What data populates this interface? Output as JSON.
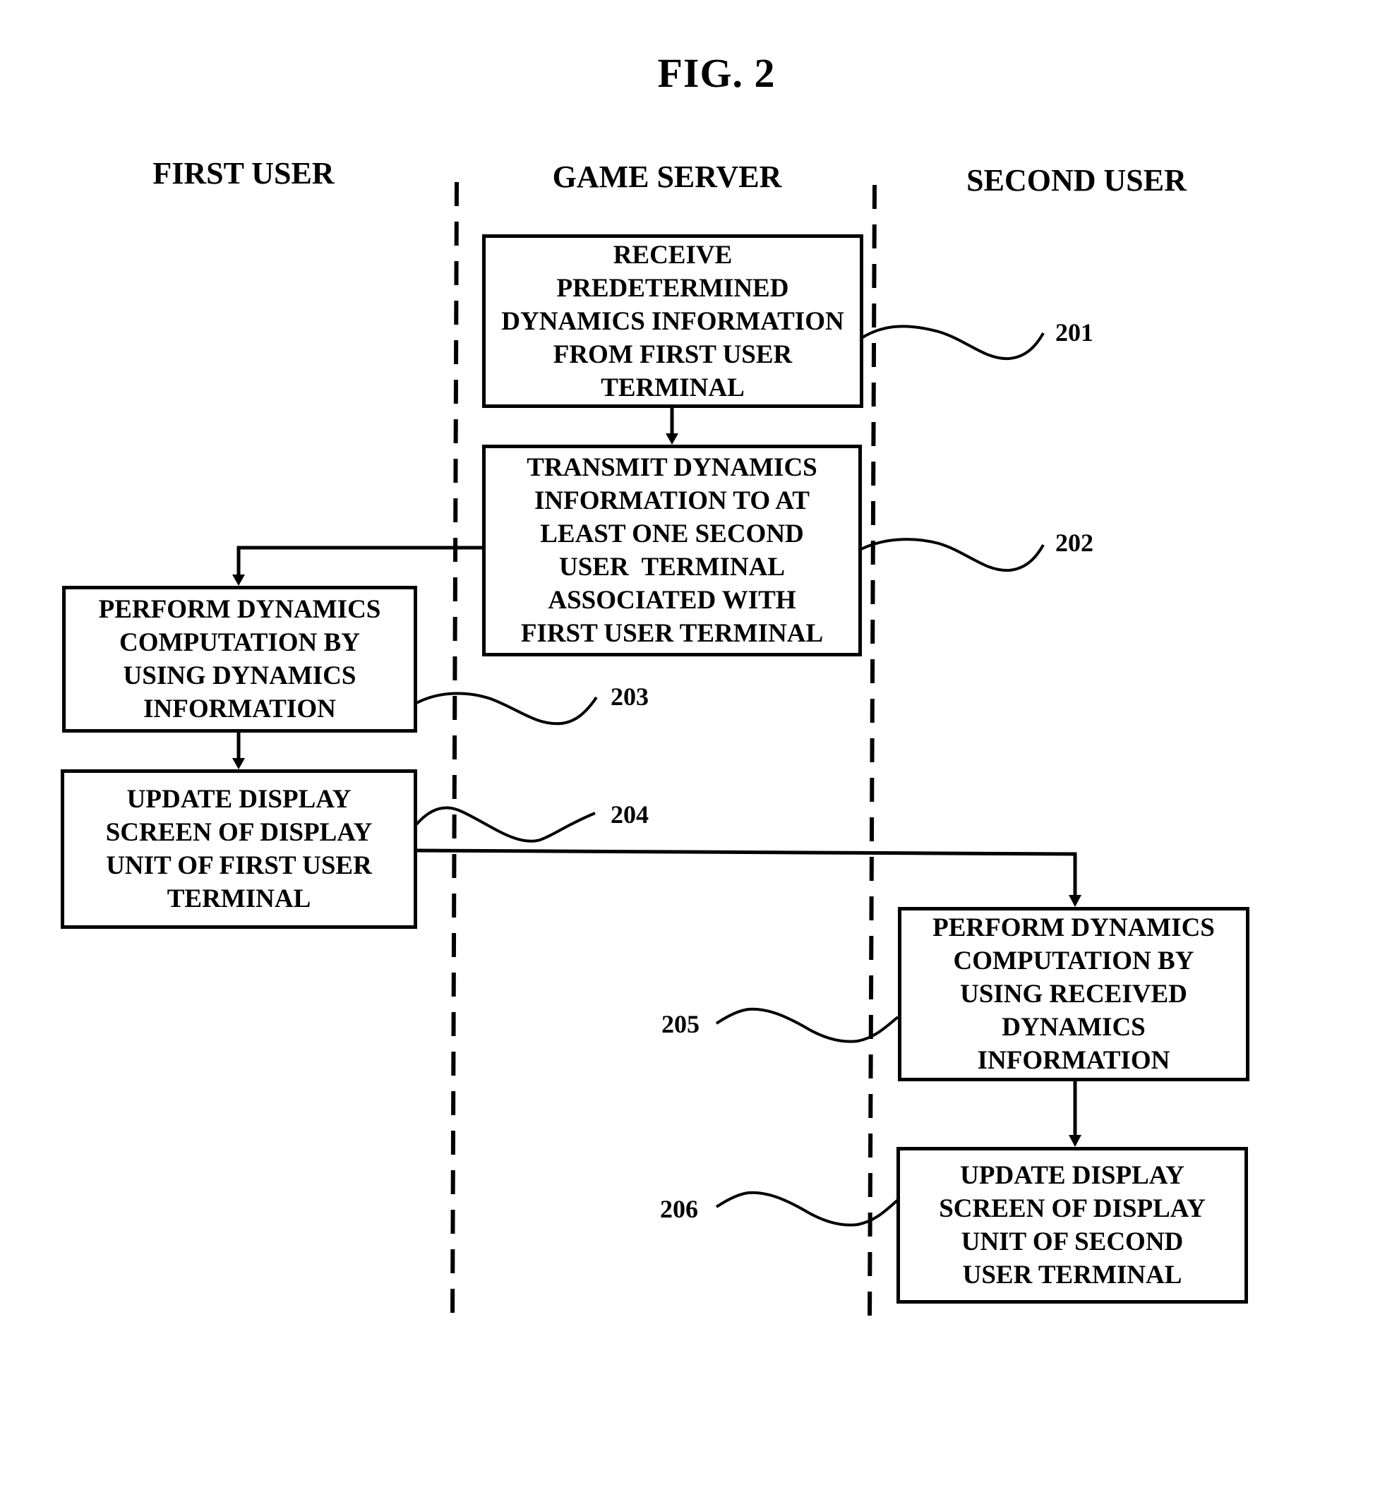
{
  "figure": {
    "title": "FIG. 2"
  },
  "lanes": {
    "first_user": "FIRST USER",
    "game_server": "GAME SERVER",
    "second_user": "SECOND USER"
  },
  "steps": [
    {
      "ref": "201",
      "lane": "game_server",
      "lines": [
        "RECEIVE",
        "PREDETERMINED",
        "DYNAMICS INFORMATION",
        "FROM FIRST USER",
        "TERMINAL"
      ]
    },
    {
      "ref": "202",
      "lane": "game_server",
      "lines": [
        "TRANSMIT DYNAMICS",
        "INFORMATION TO AT",
        "LEAST ONE SECOND",
        "USER  TERMINAL",
        "ASSOCIATED WITH",
        "FIRST USER TERMINAL"
      ]
    },
    {
      "ref": "203",
      "lane": "first_user",
      "lines": [
        "PERFORM DYNAMICS",
        "COMPUTATION BY",
        "USING DYNAMICS",
        "INFORMATION"
      ]
    },
    {
      "ref": "204",
      "lane": "first_user",
      "lines": [
        "UPDATE DISPLAY",
        "SCREEN OF DISPLAY",
        "UNIT OF FIRST USER",
        "TERMINAL"
      ]
    },
    {
      "ref": "205",
      "lane": "second_user",
      "lines": [
        "PERFORM DYNAMICS",
        "COMPUTATION BY",
        "USING RECEIVED",
        "DYNAMICS",
        "INFORMATION"
      ]
    },
    {
      "ref": "206",
      "lane": "second_user",
      "lines": [
        "UPDATE DISPLAY",
        "SCREEN OF DISPLAY",
        "UNIT OF SECOND",
        "USER TERMINAL"
      ]
    }
  ],
  "flows": [
    {
      "from": "201",
      "to": "202"
    },
    {
      "from": "202",
      "to": "203"
    },
    {
      "from": "203",
      "to": "204"
    },
    {
      "from": "204",
      "to": "205"
    },
    {
      "from": "205",
      "to": "206"
    }
  ]
}
